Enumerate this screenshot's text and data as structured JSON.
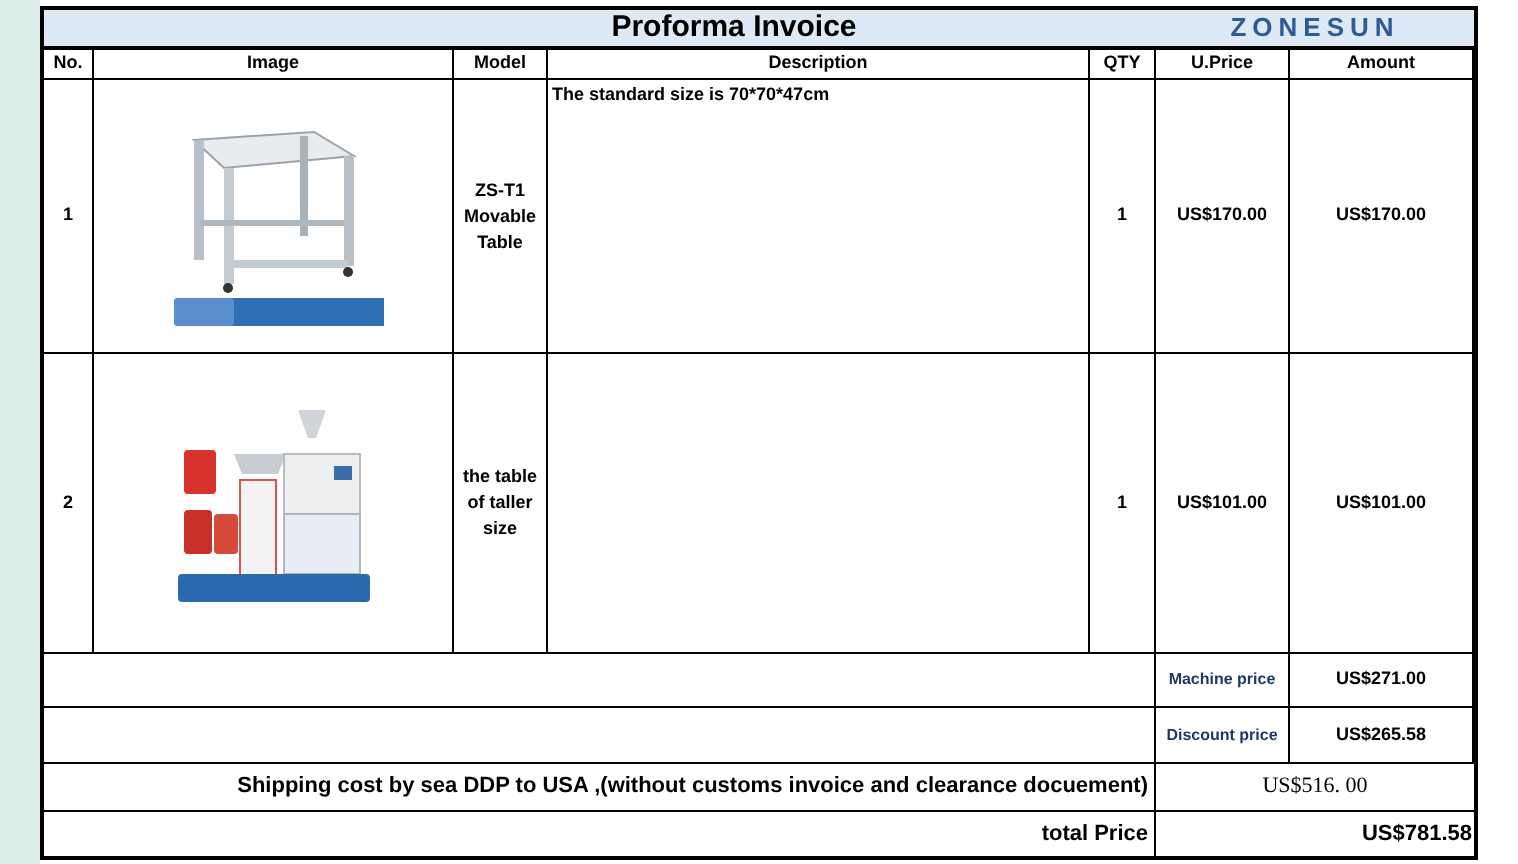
{
  "title": "Proforma Invoice",
  "logo": "ZONESUN",
  "columns": [
    "No.",
    "Image",
    "Model",
    "Description",
    "QTY",
    "U.Price",
    "Amount"
  ],
  "rows": [
    {
      "no": "1",
      "model": "ZS-T1 Movable Table",
      "description": "The standard size is 70*70*47cm",
      "qty": "1",
      "unit_price": "US$170.00",
      "amount": "US$170.00"
    },
    {
      "no": "2",
      "model": "the table of taller size",
      "qty": "1",
      "unit_price": "US$101.00",
      "amount": "US$101.00"
    }
  ],
  "machine_price": {
    "label": "Machine price",
    "value": "US$271.00"
  },
  "discount_price": {
    "label": "Discount price",
    "value": "US$265.58"
  },
  "shipping": {
    "label": "Shipping cost by sea DDP to USA ,(without customs invoice and clearance docuement)",
    "value": "US$516. 00"
  },
  "total": {
    "label": "total  Price",
    "value": "US$781.58"
  }
}
